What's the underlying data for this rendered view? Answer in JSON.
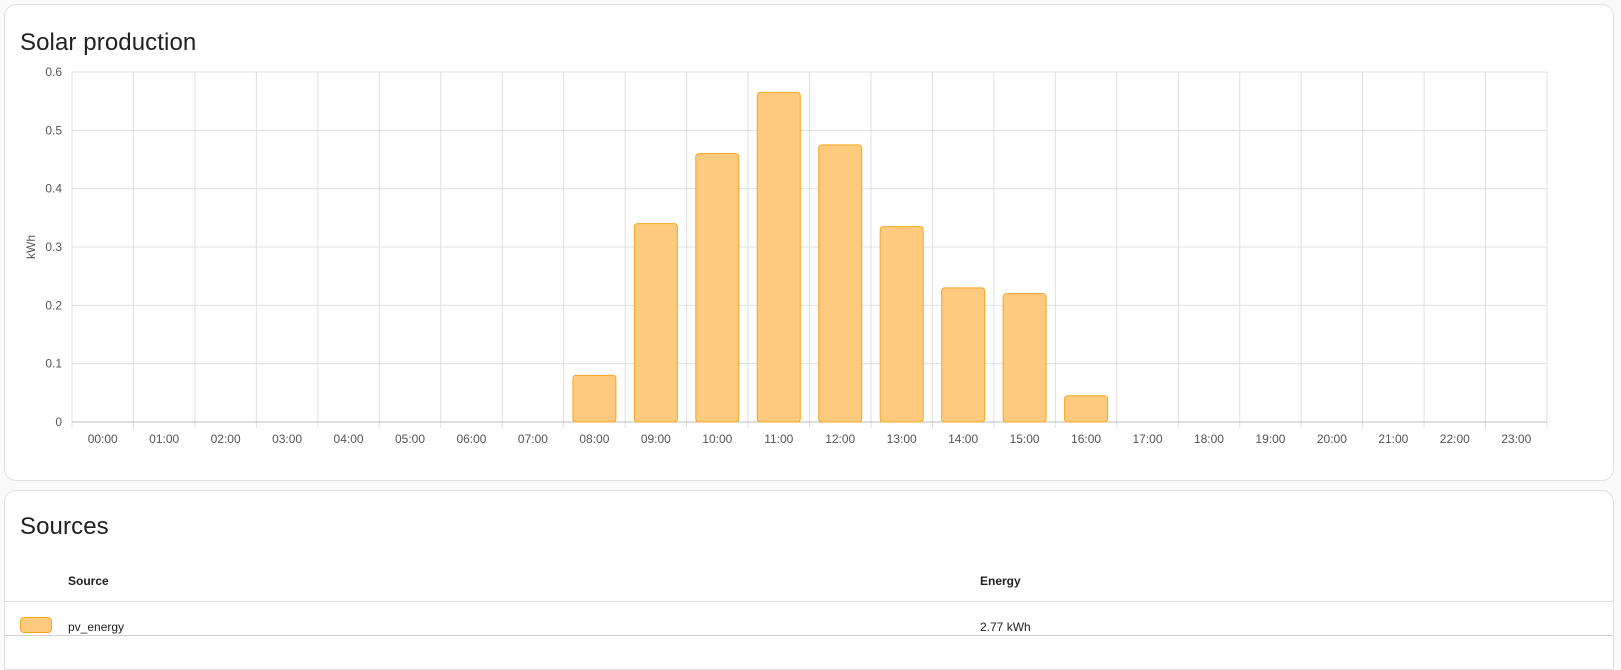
{
  "solar_card": {
    "title": "Solar production"
  },
  "sources_card": {
    "title": "Sources",
    "columns": [
      "Source",
      "Energy"
    ],
    "rows": [
      {
        "source": "pv_energy",
        "energy": "2.77 kWh",
        "swatch_icon": "series-color-swatch"
      }
    ]
  },
  "colors": {
    "bar_fill": "#fdca7e",
    "bar_stroke": "#f5a623",
    "grid": "#e0e0e0"
  },
  "chart_data": {
    "type": "bar",
    "ylabel": "kWh",
    "ylim": [
      0,
      0.6
    ],
    "yticks": [
      "0",
      "0.1",
      "0.2",
      "0.3",
      "0.4",
      "0.5",
      "0.6"
    ],
    "ytick_values": [
      0,
      0.1,
      0.2,
      0.3,
      0.4,
      0.5,
      0.6
    ],
    "categories": [
      "00:00",
      "01:00",
      "02:00",
      "03:00",
      "04:00",
      "05:00",
      "06:00",
      "07:00",
      "08:00",
      "09:00",
      "10:00",
      "11:00",
      "12:00",
      "13:00",
      "14:00",
      "15:00",
      "16:00",
      "17:00",
      "18:00",
      "19:00",
      "20:00",
      "21:00",
      "22:00",
      "23:00"
    ],
    "values": [
      0,
      0,
      0,
      0,
      0,
      0,
      0,
      0,
      0.08,
      0.34,
      0.46,
      0.565,
      0.475,
      0.335,
      0.23,
      0.22,
      0.045,
      0,
      0,
      0,
      0,
      0,
      0,
      0
    ],
    "grid": true,
    "legend": "none"
  }
}
